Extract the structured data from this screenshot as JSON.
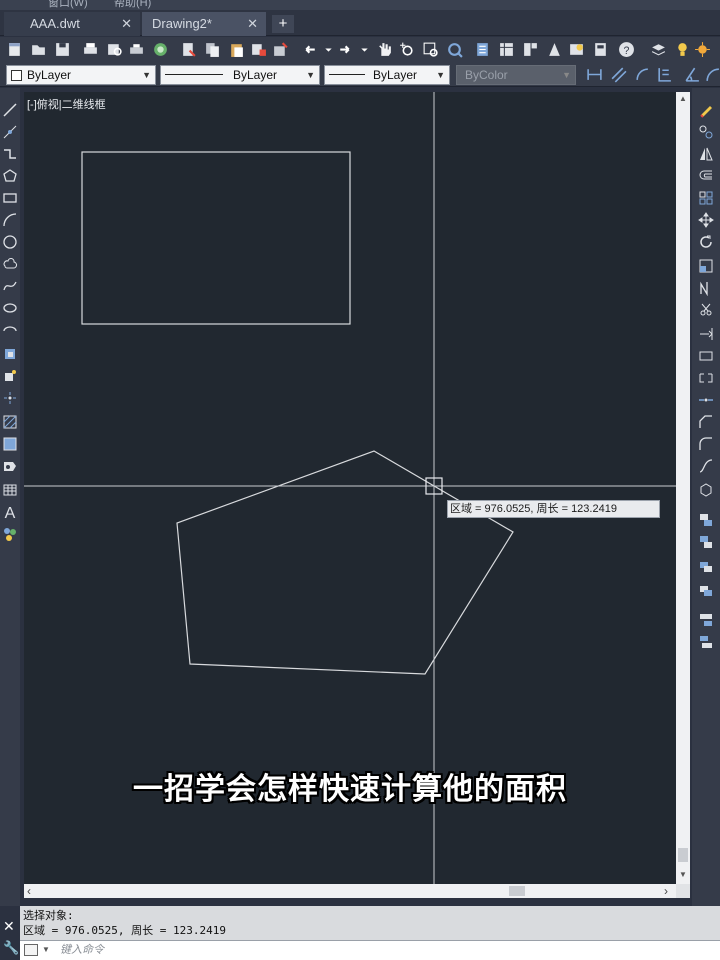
{
  "menu": [
    "窗口(W)",
    "帮助(H)"
  ],
  "tabs": [
    {
      "label": "AAA.dwt",
      "close": "✕"
    },
    {
      "label": "Drawing2*",
      "close": "✕"
    }
  ],
  "tab_add": "+",
  "properties": {
    "color": "ByLayer",
    "linetype": "ByLayer",
    "lineweight": "ByLayer",
    "plotstyle": "ByColor"
  },
  "viewport": {
    "label": "[-]俯视|二维线框"
  },
  "tooltip": "区域 = 976.0525, 周长 = 123.2419",
  "subtitle": "一招学会怎样快速计算他的面积",
  "command": {
    "history_1": "选择对象:",
    "history_2": "区域 = 976.0525, 周长 = 123.2419",
    "placeholder": "键入命令"
  },
  "colors": {
    "canvas": "#212830",
    "ui": "#353b49",
    "geometry": "#d8dadd"
  }
}
